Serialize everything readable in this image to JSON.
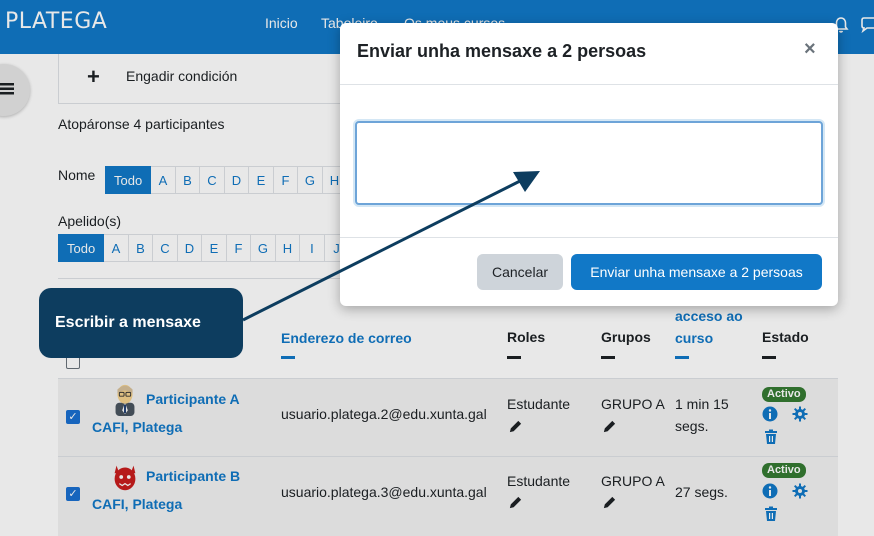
{
  "navbar": {
    "brand": "PLATEGA",
    "links": [
      "Inicio",
      "Taboleiro",
      "Os meus cursos"
    ]
  },
  "filters": {
    "add_condition": "Engadir condición"
  },
  "participants": {
    "found_text": "Atopáronse 4 participantes",
    "name_label": "Nome",
    "surname_label": "Apelido(s)",
    "name_initials": [
      "Todo",
      "A",
      "B",
      "C",
      "D",
      "E",
      "F",
      "G",
      "H"
    ],
    "surname_initials": [
      "Todo",
      "A",
      "B",
      "C",
      "D",
      "E",
      "F",
      "G",
      "H",
      "I",
      "J"
    ]
  },
  "table": {
    "headers": {
      "email": "Enderezo de correo",
      "roles": "Roles",
      "groups": "Grupos",
      "last_access_1": "acceso ao",
      "last_access_2": "curso",
      "status": "Estado"
    },
    "rows": [
      {
        "name_line1": "Participante A",
        "name_line2": "CAFI, Platega",
        "email": "usuario.platega.2@edu.xunta.gal",
        "role": "Estudante",
        "group": "GRUPO A",
        "access_line1": "1 min 15",
        "access_line2": "segs.",
        "status": "Activo"
      },
      {
        "name_line1": "Participante B",
        "name_line2": "CAFI, Platega",
        "email": "usuario.platega.3@edu.xunta.gal",
        "role": "Estudante",
        "group": "GRUPO A",
        "access_line1": "27 segs.",
        "access_line2": "",
        "status": "Activo"
      }
    ]
  },
  "modal": {
    "title": "Enviar unha mensaxe a 2 persoas",
    "close_symbol": "×",
    "message_value": "",
    "cancel_label": "Cancelar",
    "send_label": "Enviar unha mensaxe a 2 persoas"
  },
  "callout": {
    "text": "Escribir a mensaxe"
  },
  "colors": {
    "brand": "#1178c7",
    "callout": "#0d3d5f",
    "badge_active": "#357a32"
  }
}
